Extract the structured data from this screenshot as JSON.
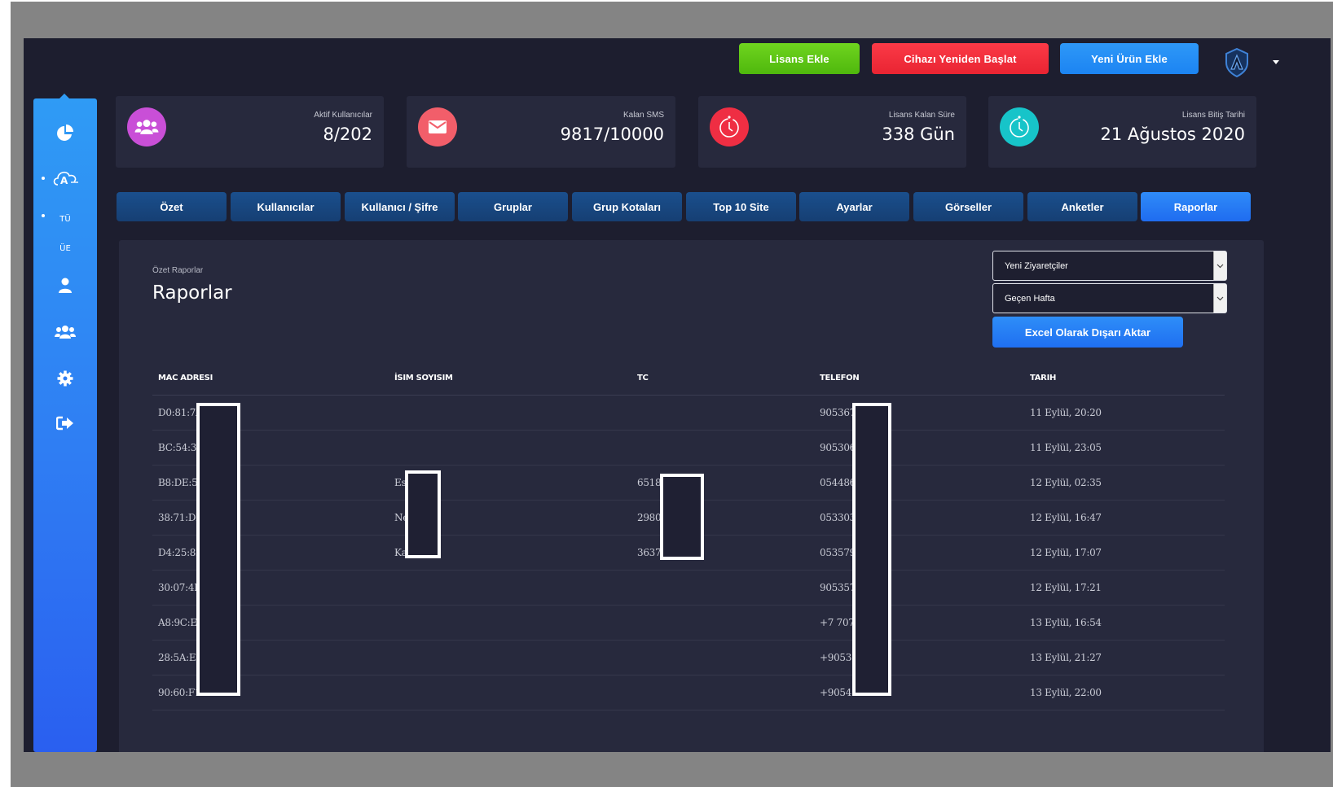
{
  "header": {
    "buttons": {
      "add_license": "Lisans Ekle",
      "restart_device": "Cihazı Yeniden Başlat",
      "add_product": "Yeni Ürün Ekle"
    },
    "colors": {
      "green": "#5ec716",
      "red": "#f02e3c",
      "blue": "#238cf5"
    }
  },
  "sidebar": {
    "items": [
      {
        "icon": "pie-chart-icon"
      },
      {
        "icon": "cloud-a-icon"
      },
      {
        "icon": "tu-text",
        "label": "TÜ"
      },
      {
        "icon": "ue-text",
        "label": "ÜE"
      },
      {
        "icon": "user-icon"
      },
      {
        "icon": "users-icon"
      },
      {
        "icon": "gear-icon"
      },
      {
        "icon": "logout-icon"
      }
    ]
  },
  "stats": [
    {
      "label": "Aktif Kullanıcılar",
      "value": "8/202",
      "icon": "users-icon",
      "color": "#c94fd7"
    },
    {
      "label": "Kalan SMS",
      "value": "9817/10000",
      "icon": "envelope-icon",
      "color": "#f25e6a"
    },
    {
      "label": "Lisans Kalan Süre",
      "value": "338 Gün",
      "icon": "timer-icon",
      "color": "#ef2e43"
    },
    {
      "label": "Lisans Bitiş Tarihi",
      "value": "21 Ağustos 2020",
      "icon": "timer-icon",
      "color": "#17c4c9"
    }
  ],
  "tabs": [
    {
      "label": "Özet"
    },
    {
      "label": "Kullanıcılar"
    },
    {
      "label": "Kullanıcı / Şifre"
    },
    {
      "label": "Gruplar"
    },
    {
      "label": "Grup Kotaları"
    },
    {
      "label": "Top 10 Site"
    },
    {
      "label": "Ayarlar"
    },
    {
      "label": "Görseller"
    },
    {
      "label": "Anketler"
    },
    {
      "label": "Raporlar",
      "active": true
    }
  ],
  "panel": {
    "breadcrumb": "Özet Raporlar",
    "title": "Raporlar",
    "report_select": "Yeni Ziyaretçiler",
    "period_select": "Geçen Hafta",
    "export_label": "Excel Olarak Dışarı Aktar",
    "columns": [
      "MAC ADRESI",
      "İSIM SOYISIM",
      "TC",
      "TELEFON",
      "TARIH"
    ],
    "rows": [
      [
        "D0:81:7A",
        "",
        "",
        "905367",
        "11 Eylül, 20:20"
      ],
      [
        "BC:54:36",
        "",
        "",
        "905306",
        "11 Eylül, 23:05"
      ],
      [
        "B8:DE:5E",
        "Es                ş",
        "6518",
        "054486",
        "12 Eylül, 02:35"
      ],
      [
        "38:71:DE                ",
        "Ne                Daş",
        "2980",
        "053303",
        "12 Eylül, 16:47"
      ],
      [
        "D4:25:8B",
        "Ka                rı",
        "3637",
        "053579",
        "12 Eylül, 17:07"
      ],
      [
        "30:07:4D",
        "",
        "",
        "905357",
        "12 Eylül, 17:21"
      ],
      [
        "A8:9C:ED",
        "",
        "",
        "+7 7072",
        "13 Eylül, 16:54"
      ],
      [
        "28:5A:EB",
        "",
        "",
        "+90533",
        "13 Eylül, 21:27"
      ],
      [
        "90:60:F1",
        "",
        "",
        "+90545",
        "13 Eylül, 22:00"
      ]
    ]
  }
}
